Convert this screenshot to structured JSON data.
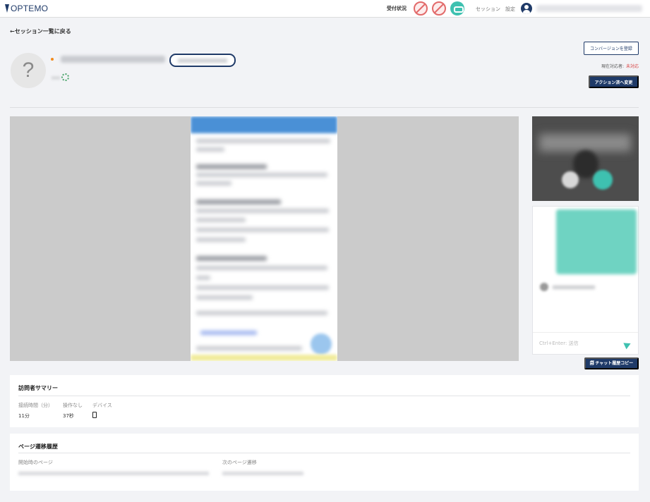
{
  "header": {
    "logo_text": "OPTEMO",
    "status_label": "受付状況",
    "nav": {
      "session": "セッション",
      "settings": "設定"
    },
    "status_icons": [
      "chat-off-icon",
      "call-off-icon",
      "video-on-icon"
    ]
  },
  "back_link": "←セッション一覧に戻る",
  "visitor": {
    "avatar_glyph": "?"
  },
  "actions": {
    "register_conversion": "コンバージョンを登録",
    "responder_label": "現在対応者:",
    "responder_value": "未対応",
    "change_action": "アクション済へ変更",
    "copy_chat": "🗐 チャット履歴コピー"
  },
  "chat": {
    "placeholder": "Ctrl+Enter: 送信"
  },
  "summary": {
    "title": "訪問者サマリー",
    "labels": [
      "接続時間（分）",
      "操作なし",
      "デバイス"
    ],
    "values": [
      "11分",
      "37秒"
    ],
    "device_icon": "mobile-icon"
  },
  "history": {
    "title": "ページ遷移履歴",
    "start_label": "開始時のページ",
    "next_label": "次のページ遷移"
  },
  "colors": {
    "brand": "#1f3a68",
    "accent": "#3ec1b0",
    "alert": "#d63a3a",
    "online": "#f28a1c"
  }
}
